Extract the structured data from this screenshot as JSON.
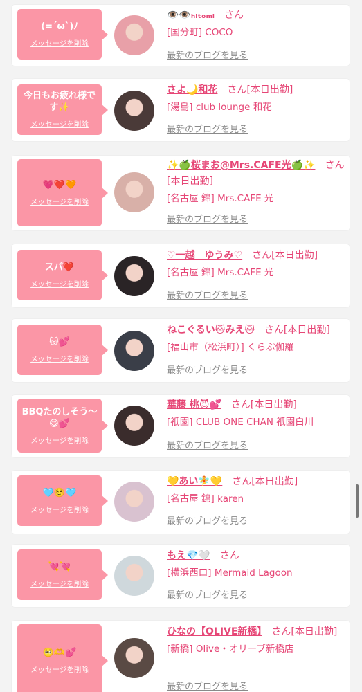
{
  "delete_label": "メッセージを削除",
  "blog_label": "最新のブログを見る",
  "cards": [
    {
      "message": "(=´ω`)ﾉ",
      "name": "👁️👁️ₕᵢₜₒₘᵢ",
      "suffix": "さん",
      "shop": "[国分町] COCO"
    },
    {
      "message": "今日もお疲れ様です✨",
      "name": "さよ🌙和花",
      "suffix": "さん[本日出勤]",
      "shop": "[湯島] club lounge 和花"
    },
    {
      "message": "💗❤️🧡",
      "name": "✨🍏桜まお@Mrs.CAFE光🍏✨",
      "suffix": "さん[本日出勤]",
      "shop": "[名古屋 錦] Mrs.CAFE 光"
    },
    {
      "message": "スパ❤️",
      "name": "♡一越　ゆうみ♡",
      "suffix": "さん[本日出勤]",
      "shop": "[名古屋 錦] Mrs.CAFE 光"
    },
    {
      "message": "😽💕",
      "name": "ねこぐるい🐱みえ🐱",
      "suffix": "さん[本日出勤]",
      "shop": "[福山市（松浜町）] くらぶ伽羅"
    },
    {
      "message": "BBQたのしそう〜😋💕",
      "name": "華藤 桃😈💕",
      "suffix": "さん[本日出勤]",
      "shop": "[祇園] CLUB ONE CHAN 祇園白川"
    },
    {
      "message": "🩵☺️🩵",
      "name": "💛あい🧚💛",
      "suffix": "さん[本日出勤]",
      "shop": "[名古屋 錦] karen"
    },
    {
      "message": "💘💘",
      "name": "もえ💎🤍",
      "suffix": "さん",
      "shop": "[横浜西口] Mermaid Lagoon"
    },
    {
      "message": "🥺🫶💕",
      "name": "ひなの【OLIVE新橋】",
      "suffix": "さん[本日出勤]",
      "shop": "[新橋] Olive・オリーブ新橋店"
    }
  ],
  "colors": {
    "background": "#f3f3f3",
    "bubble": "#fb96a6",
    "accent": "#e64676",
    "blog_link": "#8a8a8a",
    "avatar_tones": [
      "#e8a0a8",
      "#4a3a38",
      "#d8b0a8",
      "#2a2426",
      "#3a3e48",
      "#3a2c2c",
      "#d9c2d0",
      "#cfd8dc",
      "#5a4a44"
    ]
  }
}
